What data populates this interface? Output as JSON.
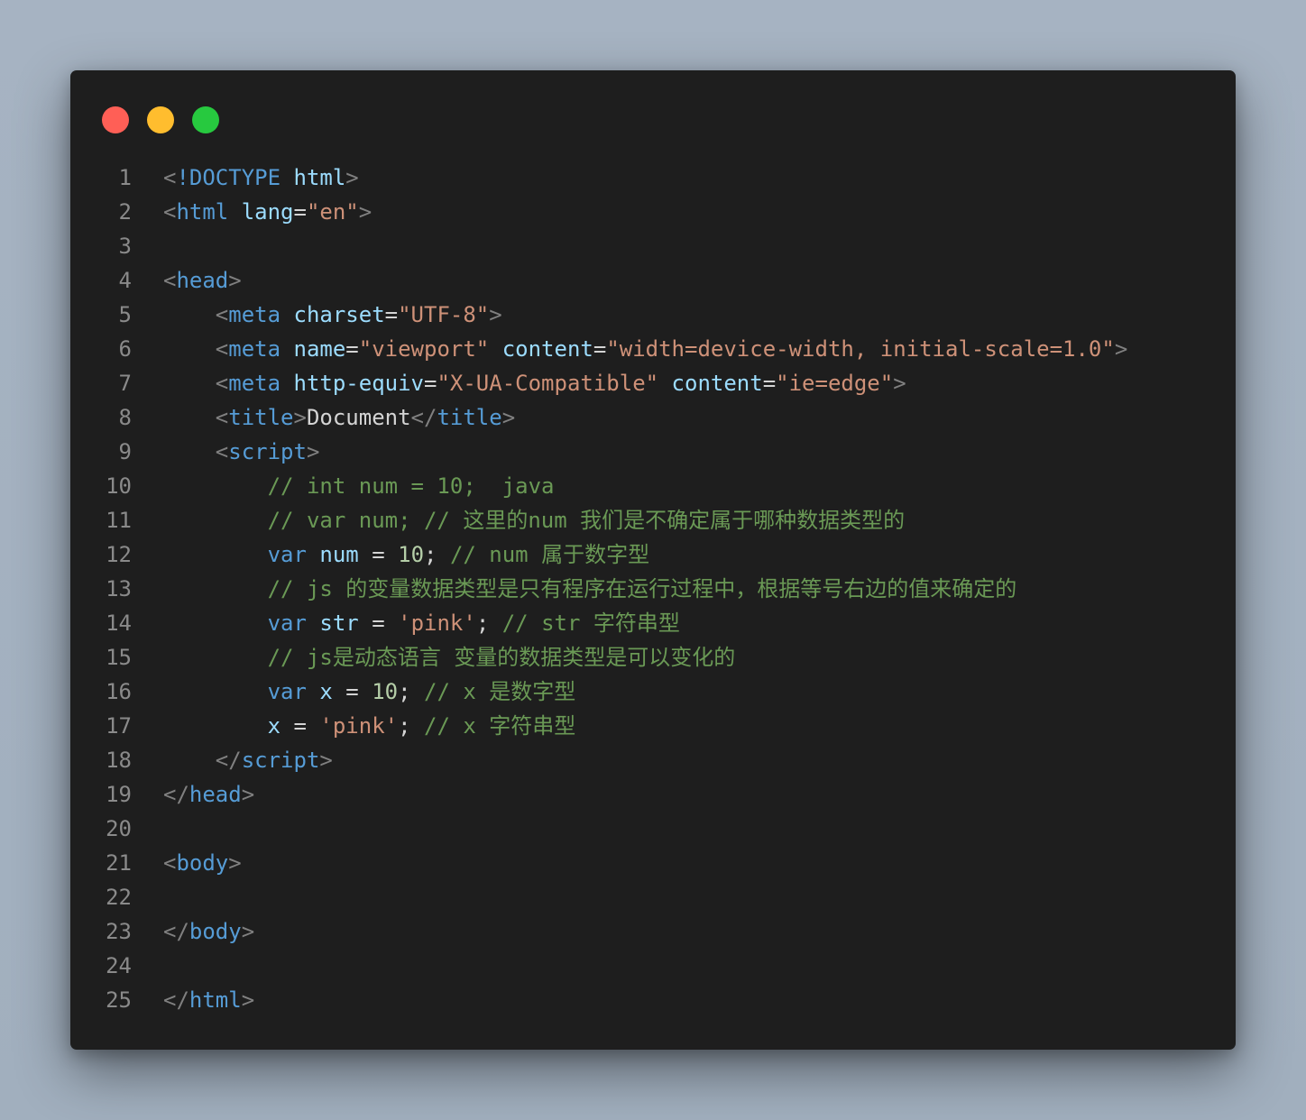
{
  "window": {
    "buttons": [
      {
        "name": "close",
        "color": "#ff5f56"
      },
      {
        "name": "minimize",
        "color": "#ffbd2e"
      },
      {
        "name": "zoom",
        "color": "#27c93f"
      }
    ]
  },
  "colors": {
    "background": "#1e1e1e",
    "line_number": "#8a8a8a",
    "punct": "#808080",
    "tag": "#569cd6",
    "attr": "#9cdcfe",
    "string": "#ce9178",
    "comment": "#6a9955",
    "keyword": "#569cd6",
    "variable": "#9cdcfe",
    "number": "#b5cea8",
    "text": "#d4d4d4"
  },
  "code_lines": [
    {
      "n": "1",
      "tokens": [
        [
          "punct",
          "<"
        ],
        [
          "tag",
          "!DOCTYPE"
        ],
        [
          "text",
          " "
        ],
        [
          "attr",
          "html"
        ],
        [
          "punct",
          ">"
        ]
      ]
    },
    {
      "n": "2",
      "tokens": [
        [
          "punct",
          "<"
        ],
        [
          "tag",
          "html"
        ],
        [
          "text",
          " "
        ],
        [
          "attr",
          "lang"
        ],
        [
          "text",
          "="
        ],
        [
          "string",
          "\"en\""
        ],
        [
          "punct",
          ">"
        ]
      ]
    },
    {
      "n": "3",
      "tokens": []
    },
    {
      "n": "4",
      "tokens": [
        [
          "punct",
          "<"
        ],
        [
          "tag",
          "head"
        ],
        [
          "punct",
          ">"
        ]
      ]
    },
    {
      "n": "5",
      "tokens": [
        [
          "text",
          "    "
        ],
        [
          "punct",
          "<"
        ],
        [
          "tag",
          "meta"
        ],
        [
          "text",
          " "
        ],
        [
          "attr",
          "charset"
        ],
        [
          "text",
          "="
        ],
        [
          "string",
          "\"UTF-8\""
        ],
        [
          "punct",
          ">"
        ]
      ]
    },
    {
      "n": "6",
      "tokens": [
        [
          "text",
          "    "
        ],
        [
          "punct",
          "<"
        ],
        [
          "tag",
          "meta"
        ],
        [
          "text",
          " "
        ],
        [
          "attr",
          "name"
        ],
        [
          "text",
          "="
        ],
        [
          "string",
          "\"viewport\""
        ],
        [
          "text",
          " "
        ],
        [
          "attr",
          "content"
        ],
        [
          "text",
          "="
        ],
        [
          "string",
          "\"width=device-width, initial-scale=1.0\""
        ],
        [
          "punct",
          ">"
        ]
      ]
    },
    {
      "n": "7",
      "tokens": [
        [
          "text",
          "    "
        ],
        [
          "punct",
          "<"
        ],
        [
          "tag",
          "meta"
        ],
        [
          "text",
          " "
        ],
        [
          "attr",
          "http-equiv"
        ],
        [
          "text",
          "="
        ],
        [
          "string",
          "\"X-UA-Compatible\""
        ],
        [
          "text",
          " "
        ],
        [
          "attr",
          "content"
        ],
        [
          "text",
          "="
        ],
        [
          "string",
          "\"ie=edge\""
        ],
        [
          "punct",
          ">"
        ]
      ]
    },
    {
      "n": "8",
      "tokens": [
        [
          "text",
          "    "
        ],
        [
          "punct",
          "<"
        ],
        [
          "tag",
          "title"
        ],
        [
          "punct",
          ">"
        ],
        [
          "text",
          "Document"
        ],
        [
          "punct",
          "</"
        ],
        [
          "tag",
          "title"
        ],
        [
          "punct",
          ">"
        ]
      ]
    },
    {
      "n": "9",
      "tokens": [
        [
          "text",
          "    "
        ],
        [
          "punct",
          "<"
        ],
        [
          "tag",
          "script"
        ],
        [
          "punct",
          ">"
        ]
      ]
    },
    {
      "n": "10",
      "tokens": [
        [
          "text",
          "        "
        ],
        [
          "comment",
          "// int num = 10;  java"
        ]
      ]
    },
    {
      "n": "11",
      "tokens": [
        [
          "text",
          "        "
        ],
        [
          "comment",
          "// var num; // 这里的num 我们是不确定属于哪种数据类型的"
        ]
      ]
    },
    {
      "n": "12",
      "tokens": [
        [
          "text",
          "        "
        ],
        [
          "keyword",
          "var"
        ],
        [
          "text",
          " "
        ],
        [
          "variable",
          "num"
        ],
        [
          "text",
          " = "
        ],
        [
          "number",
          "10"
        ],
        [
          "text",
          "; "
        ],
        [
          "comment",
          "// num 属于数字型"
        ]
      ]
    },
    {
      "n": "13",
      "tokens": [
        [
          "text",
          "        "
        ],
        [
          "comment",
          "// js 的变量数据类型是只有程序在运行过程中，根据等号右边的值来确定的"
        ]
      ]
    },
    {
      "n": "14",
      "tokens": [
        [
          "text",
          "        "
        ],
        [
          "keyword",
          "var"
        ],
        [
          "text",
          " "
        ],
        [
          "variable",
          "str"
        ],
        [
          "text",
          " = "
        ],
        [
          "string",
          "'pink'"
        ],
        [
          "text",
          "; "
        ],
        [
          "comment",
          "// str 字符串型"
        ]
      ]
    },
    {
      "n": "15",
      "tokens": [
        [
          "text",
          "        "
        ],
        [
          "comment",
          "// js是动态语言 变量的数据类型是可以变化的"
        ]
      ]
    },
    {
      "n": "16",
      "tokens": [
        [
          "text",
          "        "
        ],
        [
          "keyword",
          "var"
        ],
        [
          "text",
          " "
        ],
        [
          "variable",
          "x"
        ],
        [
          "text",
          " = "
        ],
        [
          "number",
          "10"
        ],
        [
          "text",
          "; "
        ],
        [
          "comment",
          "// x 是数字型"
        ]
      ]
    },
    {
      "n": "17",
      "tokens": [
        [
          "text",
          "        "
        ],
        [
          "variable",
          "x"
        ],
        [
          "text",
          " = "
        ],
        [
          "string",
          "'pink'"
        ],
        [
          "text",
          "; "
        ],
        [
          "comment",
          "// x 字符串型"
        ]
      ]
    },
    {
      "n": "18",
      "tokens": [
        [
          "text",
          "    "
        ],
        [
          "punct",
          "</"
        ],
        [
          "tag",
          "script"
        ],
        [
          "punct",
          ">"
        ]
      ]
    },
    {
      "n": "19",
      "tokens": [
        [
          "punct",
          "</"
        ],
        [
          "tag",
          "head"
        ],
        [
          "punct",
          ">"
        ]
      ]
    },
    {
      "n": "20",
      "tokens": []
    },
    {
      "n": "21",
      "tokens": [
        [
          "punct",
          "<"
        ],
        [
          "tag",
          "body"
        ],
        [
          "punct",
          ">"
        ]
      ]
    },
    {
      "n": "22",
      "tokens": []
    },
    {
      "n": "23",
      "tokens": [
        [
          "punct",
          "</"
        ],
        [
          "tag",
          "body"
        ],
        [
          "punct",
          ">"
        ]
      ]
    },
    {
      "n": "24",
      "tokens": []
    },
    {
      "n": "25",
      "tokens": [
        [
          "punct",
          "</"
        ],
        [
          "tag",
          "html"
        ],
        [
          "punct",
          ">"
        ]
      ]
    }
  ]
}
